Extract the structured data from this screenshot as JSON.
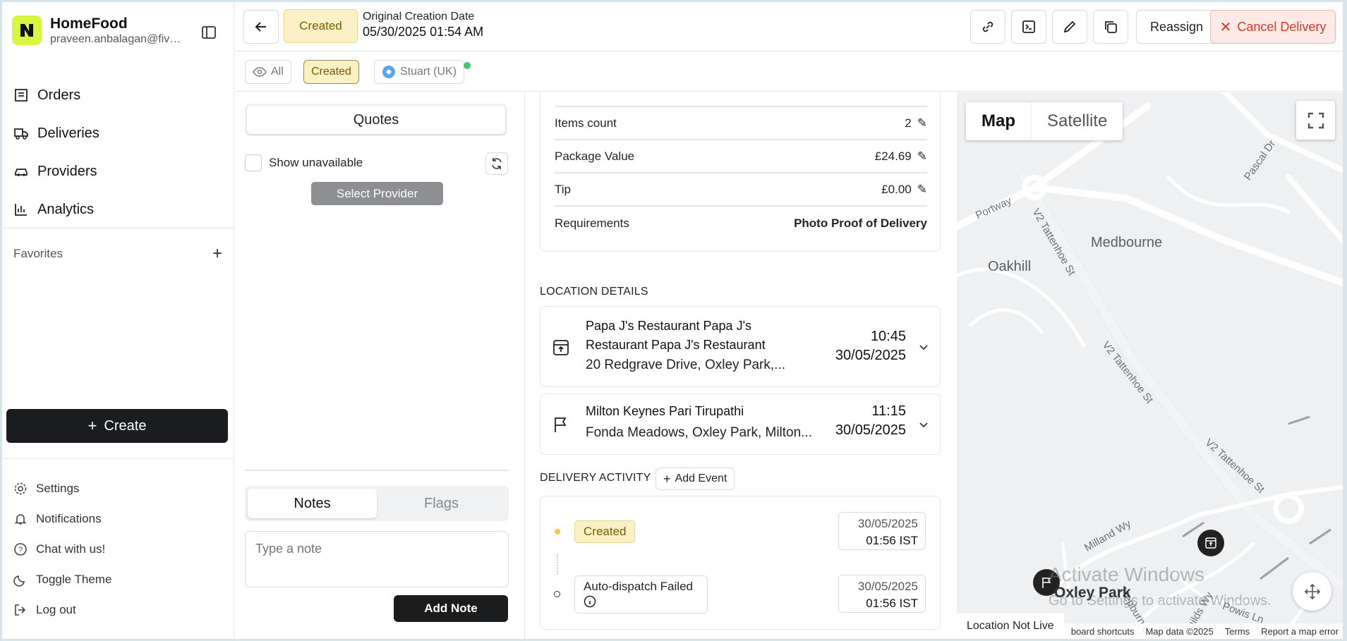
{
  "brand": {
    "name": "HomeFood",
    "email": "praveen.anbalagan@five..."
  },
  "nav": [
    {
      "label": "Orders",
      "icon": "orders-icon"
    },
    {
      "label": "Deliveries",
      "icon": "truck-icon"
    },
    {
      "label": "Providers",
      "icon": "car-icon"
    },
    {
      "label": "Analytics",
      "icon": "chart-icon"
    }
  ],
  "favorites": {
    "label": "Favorites"
  },
  "create": {
    "label": "Create"
  },
  "footer_nav": [
    {
      "label": "Settings",
      "icon": "gear-icon"
    },
    {
      "label": "Notifications",
      "icon": "bell-icon"
    },
    {
      "label": "Chat with us!",
      "icon": "help-icon"
    },
    {
      "label": "Toggle Theme",
      "icon": "moon-icon"
    },
    {
      "label": "Log out",
      "icon": "logout-icon"
    }
  ],
  "header": {
    "status": "Created",
    "creation_label": "Original Creation Date",
    "creation_value": "05/30/2025 01:54 AM",
    "reassign": "Reassign",
    "cancel": "Cancel Delivery"
  },
  "filters": {
    "all": "All",
    "created": "Created",
    "provider": "Stuart (UK)"
  },
  "quotes": {
    "tab": "Quotes",
    "show_unavailable": "Show unavailable",
    "select_provider": "Select Provider"
  },
  "notes": {
    "tab_notes": "Notes",
    "tab_flags": "Flags",
    "placeholder": "Type a note",
    "add_button": "Add Note"
  },
  "details": [
    {
      "label": "Items count",
      "value": "2"
    },
    {
      "label": "Package Value",
      "value": "£24.69"
    },
    {
      "label": "Tip",
      "value": "£0.00"
    },
    {
      "label": "Requirements",
      "value": "Photo Proof of Delivery"
    }
  ],
  "location_title": "LOCATION DETAILS",
  "pickup": {
    "name_line1": "Papa J's Restaurant Papa J's",
    "name_line2": "Restaurant Papa J's Restaurant",
    "address": "20 Redgrave Drive, Oxley Park,...",
    "time": "10:45",
    "date": "30/05/2025"
  },
  "dropoff": {
    "name": "Milton Keynes Pari Tirupathi",
    "address": "Fonda Meadows, Oxley Park, Milton...",
    "time": "11:15",
    "date": "30/05/2025"
  },
  "activity": {
    "title": "DELIVERY ACTIVITY",
    "add_event": "Add Event",
    "events": [
      {
        "label": "Created",
        "date": "30/05/2025",
        "time": "01:56 IST"
      },
      {
        "label": "Auto-dispatch Failed",
        "date": "30/05/2025",
        "time": "01:56 IST"
      }
    ]
  },
  "map": {
    "map_tab": "Map",
    "satellite_tab": "Satellite",
    "places": [
      "Medbourne",
      "Oakhill",
      "Oxley Park"
    ],
    "streets": [
      "V2 Tattenhoe St",
      "V2 Tattenhoe St",
      "V2 Tattenhoe St",
      "Portway",
      "Pascal Dr",
      "Milland Wy",
      "Powis Ln",
      "Childs Wy",
      "Hepburn Cres"
    ],
    "location_status": "Location Not Live",
    "footer": [
      "board shortcuts",
      "Map data ©2025",
      "Terms",
      "Report a map error"
    ],
    "watermark_title": "Activate Windows",
    "watermark_sub": "Go to Settings to activate Windows."
  },
  "colors": {
    "accent": "#d8f542",
    "status_bg": "#fbf1c7",
    "cancel": "#d8392b",
    "dark": "#1b1c1e"
  }
}
